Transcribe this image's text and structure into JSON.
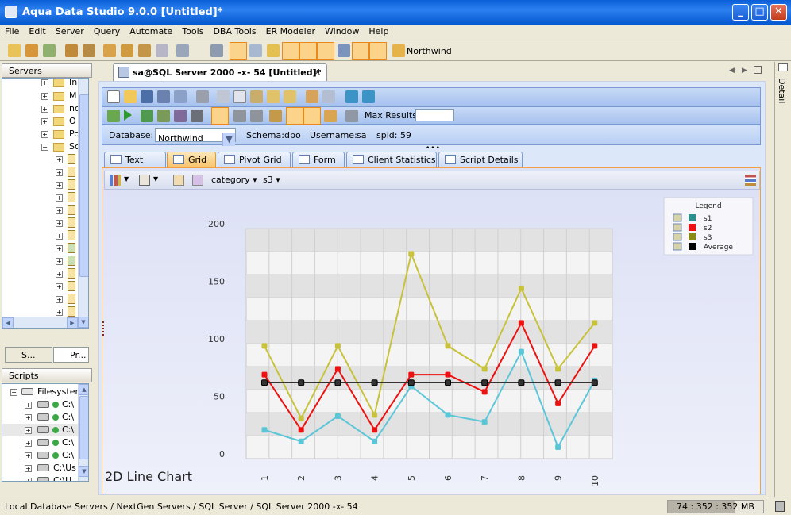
{
  "window": {
    "title": "Aqua Data Studio 9.0.0 [Untitled]*",
    "min": "_",
    "max": "□",
    "close": "✕"
  },
  "menu": [
    "File",
    "Edit",
    "Server",
    "Query",
    "Automate",
    "Tools",
    "DBA Tools",
    "ER Modeler",
    "Window",
    "Help"
  ],
  "toolbar": {
    "server_label": "Northwind"
  },
  "servers_panel": {
    "title": "Servers",
    "rows": [
      "In",
      "M",
      "nc",
      "O",
      "Po",
      "Sc"
    ]
  },
  "left_tabs": [
    "S...",
    "Pr..."
  ],
  "scripts_panel": {
    "title": "Scripts",
    "root": "Filesysten",
    "rows": [
      "C:\\",
      "C:\\",
      "C:\\",
      "C:\\",
      "C:\\",
      "C:\\Us",
      "C:\\U"
    ]
  },
  "doc_tab": {
    "title": "sa@SQL Server 2000 -x- 54 [Untitled]*",
    "close": "✕"
  },
  "query": {
    "max_results_label": "Max Results:",
    "max_results_value": "",
    "database_label": "Database:",
    "database_value": "Northwind",
    "schema_label": "Schema:",
    "schema_value": "dbo",
    "username_label": "Username:",
    "username_value": "sa",
    "spid_label": "spid:",
    "spid_value": "59"
  },
  "result_tabs": [
    "Text",
    "Grid",
    "Pivot Grid",
    "Form",
    "Client Statistics",
    "Script Details"
  ],
  "active_tab": "Grid",
  "chart_toolbar": {
    "category_label": "category",
    "series_label": "s3"
  },
  "right_strip_label": "Detail",
  "status": {
    "path": "Local Database Servers / NextGen Servers / SQL Server / SQL Server 2000 -x- 54",
    "memory": "74 : 352 : 352 MB"
  },
  "chart_data": {
    "type": "line",
    "title": "2D Line Chart",
    "categories": [
      "1",
      "2",
      "3",
      "4",
      "5",
      "6",
      "7",
      "8",
      "9",
      "10"
    ],
    "ylim": [
      0,
      200
    ],
    "yticks": [
      0,
      50,
      100,
      150,
      200
    ],
    "grid": true,
    "legend_title": "Legend",
    "legend_position": "top-right",
    "series": [
      {
        "name": "s1",
        "color": "#5bc6d8",
        "values": [
          25,
          15,
          37,
          15,
          63,
          38,
          32,
          93,
          10,
          68
        ]
      },
      {
        "name": "s2",
        "color": "#ee1111",
        "values": [
          73,
          25,
          78,
          25,
          73,
          73,
          58,
          118,
          48,
          98
        ]
      },
      {
        "name": "s3",
        "color": "#c8c23a",
        "values": [
          98,
          35,
          98,
          38,
          178,
          98,
          78,
          148,
          78,
          118
        ]
      },
      {
        "name": "Average",
        "color": "#333333",
        "values": [
          66,
          66,
          66,
          66,
          66,
          66,
          66,
          66,
          66,
          66
        ]
      }
    ]
  }
}
